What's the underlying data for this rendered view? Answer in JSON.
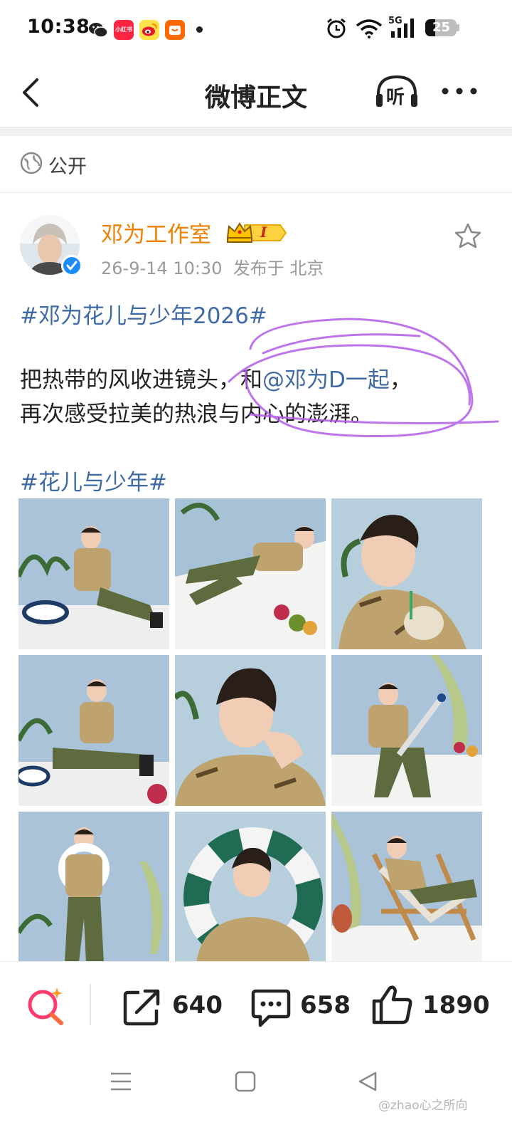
{
  "status_bar": {
    "time": "10:38",
    "app_icons": [
      "wechat-icon",
      "xiaohongshu-icon",
      "weibo-icon",
      "taobao-icon"
    ],
    "xiaohongshu_label": "小红书",
    "network": "5G",
    "battery": "25"
  },
  "header": {
    "title": "微博正文",
    "listen_label": "听"
  },
  "visibility": {
    "label": "公开"
  },
  "post": {
    "author": "邓为工作室",
    "vip_level": "I",
    "date": "26-9-14 10:30",
    "location": "发布于 北京",
    "hashtag_1": "#邓为花儿与少年2026#",
    "body_line1_a": "把热带的风收进镜头，和",
    "mention": "@邓为D一起",
    "body_line1_b": "，",
    "body_line2": "再次感受拉美的热浪与内心的澎湃。",
    "hashtag_2": "#花儿与少年#"
  },
  "actions": {
    "repost_count": "640",
    "comment_count": "658",
    "like_count": "1890"
  },
  "watermark": "@zhao心之所向",
  "colors": {
    "author": "#f08000",
    "link": "#3f6aa6",
    "annotation": "#b35ee8",
    "verified": "#1a8cff"
  }
}
